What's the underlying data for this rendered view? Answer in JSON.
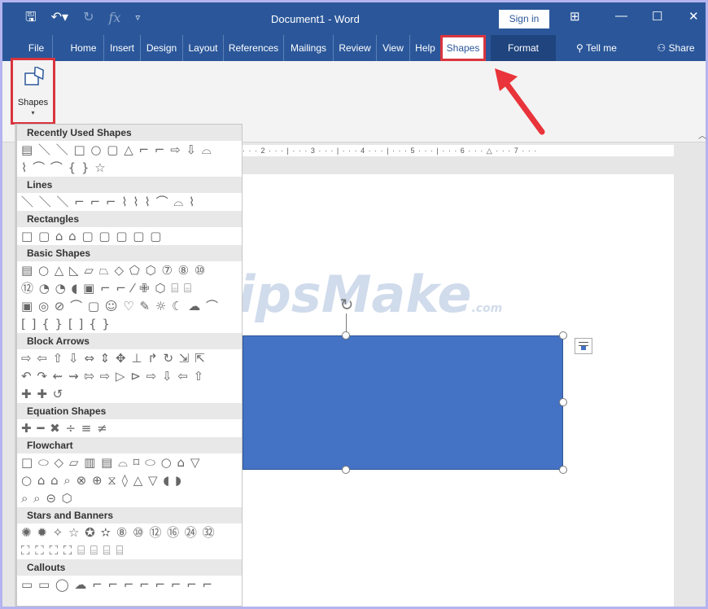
{
  "titlebar": {
    "save_icon": "save-icon",
    "undo_icon": "undo-icon",
    "redo_icon": "redo-icon",
    "fx_label": "fx",
    "customize_icon": "customize-icon",
    "document_title": "Document1 - Word",
    "signin_label": "Sign in",
    "ribbon_display_icon": "ribbon-display-icon",
    "minimize_icon": "minimize-icon",
    "maximize_icon": "maximize-icon",
    "close_icon": "close-icon"
  },
  "tabs": {
    "file": "File",
    "home": "Home",
    "insert": "Insert",
    "design": "Design",
    "layout": "Layout",
    "references": "References",
    "mailings": "Mailings",
    "review": "Review",
    "view": "View",
    "help": "Help",
    "shapes": "Shapes",
    "format": "Format",
    "tell_me": "Tell me",
    "share": "Share"
  },
  "ribbon": {
    "shapes_button_label": "Shapes",
    "dropdown_arrow": "▾"
  },
  "ruler": {
    "text": "· · · 2 · · · | · · · 3 · · · | · · · 4 · · · | · · · 5 · · · | · · · 6 · · · △ · · · 7 · · ·"
  },
  "watermark": {
    "text": "TipsMake",
    "suffix": ".com"
  },
  "gallery": {
    "sections": [
      {
        "title": "Recently Used Shapes",
        "rows": [
          "▤ ＼ ＼ □ ○ ▢ △ ⌐ ⌐ ⇨ ⇩ ⌓",
          "⌇ ⌒ ⌒ { } ☆"
        ]
      },
      {
        "title": "Lines",
        "rows": [
          "＼ ＼ ＼ ⌐ ⌐ ⌐ ⌇ ⌇ ⌇ ⌒ ⌓ ⌇"
        ]
      },
      {
        "title": "Rectangles",
        "rows": [
          "□ ▢ ⌂ ⌂ ▢ ▢ ▢ ▢ ▢"
        ]
      },
      {
        "title": "Basic Shapes",
        "rows": [
          "▤ ○ △ ◺ ▱ ⏢ ◇ ⬠ ⬡ ⑦ ⑧ ⑩",
          "⑫ ◔ ◔ ◖ ▣ ⌐ ⌐ ⁄ ✙ ⬡ ⌸ ⌸",
          "▣ ◎ ⊘ ⌒ ▢ ☺ ♡ ✎ ☼ ☾ ☁ ⌒",
          "[ ] { } [ ] { }"
        ]
      },
      {
        "title": "Block Arrows",
        "rows": [
          "⇨ ⇦ ⇧ ⇩ ⇔ ⇕ ✥ ⊥ ↱ ↻ ⇲ ⇱",
          "↶ ↷ ⇜ ⇝ ⇰ ⇨ ▷ ⊳ ⇨ ⇩ ⇦ ⇧",
          "✚ ✚ ↺"
        ]
      },
      {
        "title": "Equation Shapes",
        "rows": [
          "✚ ━ ✖ ÷ ≡ ≠"
        ]
      },
      {
        "title": "Flowchart",
        "rows": [
          "□ ⬭ ◇ ▱ ▥ ▤ ⌓ ⌑ ⬭ ○ ⌂ ▽",
          "○ ⌂ ⌂ ⌕ ⊗ ⊕ ⧖ ◊ △ ▽ ◖ ◗",
          "⌕ ⌕ ⊝ ⬡"
        ]
      },
      {
        "title": "Stars and Banners",
        "rows": [
          "✺ ✹ ✧ ☆ ✪ ✫ ⑧ ⑩ ⑫ ⑯ ㉔ ㉜",
          "⛶ ⛶ ⛶ ⛶ ⌸ ⌸ ⌸ ⌸"
        ]
      },
      {
        "title": "Callouts",
        "rows": [
          "▭ ▭ ◯ ☁ ⌐ ⌐ ⌐ ⌐ ⌐ ⌐ ⌐ ⌐"
        ]
      }
    ]
  },
  "colors": {
    "word_blue": "#2b579a",
    "shape_fill": "#4472c4",
    "highlight_red": "#d9353d"
  }
}
